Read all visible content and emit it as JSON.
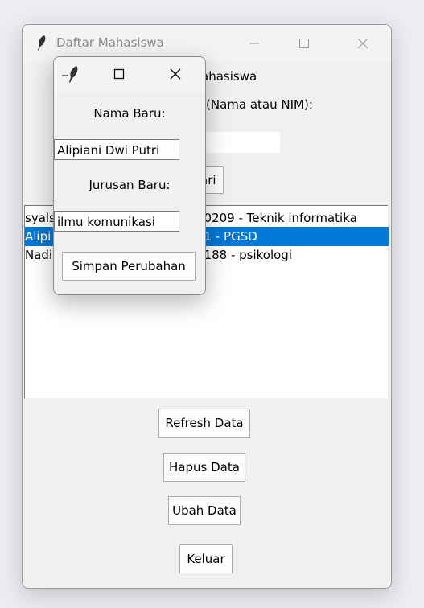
{
  "main": {
    "title": "Daftar Mahasiswa",
    "header_fragment": "ahasiswa",
    "search_label_fragment": "(Nama atau NIM):",
    "cari_fragment": "ari",
    "list": [
      {
        "left": "syals",
        "right": "10209 - Teknik informatika",
        "selected": false
      },
      {
        "left": "Alipi",
        "right": "01 - PGSD",
        "selected": true
      },
      {
        "left": "Nadi",
        "right": "0188 - psikologi",
        "selected": false
      }
    ],
    "buttons": {
      "refresh": "Refresh Data",
      "delete": "Hapus Data",
      "edit": "Ubah Data",
      "exit": "Keluar"
    }
  },
  "dialog": {
    "name_label": "Nama Baru:",
    "name_value": "Alipiani Dwi Putri",
    "major_label": "Jurusan Baru:",
    "major_value": "ilmu komunikasi",
    "save_button": "Simpan Perubahan"
  },
  "colors": {
    "selection": "#0078d7",
    "window_bg": "#f0f0f0"
  }
}
